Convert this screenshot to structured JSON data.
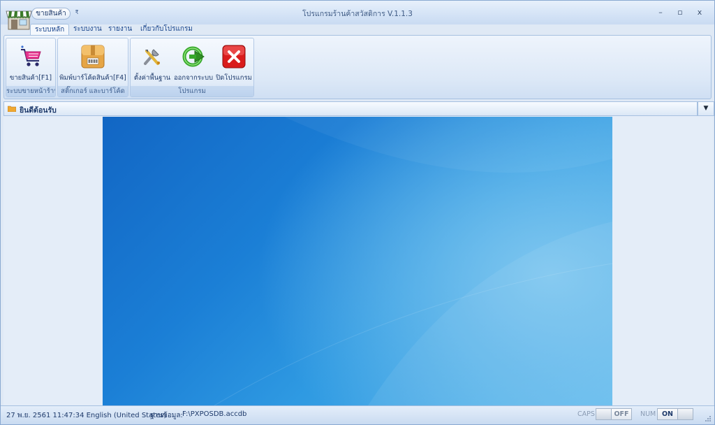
{
  "window": {
    "title": "โปรแกรมร้านค้าสวัสดิการ V.1.1.3",
    "qat_button_label": "ขายสินค้า",
    "qat_dropdown": "₹",
    "controls": {
      "minimize": "–",
      "maximize": "▫",
      "close": "x"
    }
  },
  "tabs": [
    {
      "label": "ระบบหลัก",
      "active": true
    },
    {
      "label": "ระบบงาน",
      "active": false
    },
    {
      "label": "รายงาน",
      "active": false
    },
    {
      "label": "เกี่ยวกับโปรแกรม",
      "active": false
    }
  ],
  "ribbon": {
    "groups": [
      {
        "label": "ระบบขายหน้าร้าน",
        "buttons": [
          {
            "label": "ขายสินค้า[F1]",
            "icon": "shopping-cart-icon"
          }
        ]
      },
      {
        "label": "สติ๊กเกอร์ และบาร์โค้ด",
        "buttons": [
          {
            "label": "พิมพ์บาร์โค้ดสินค้า[F4]",
            "icon": "barcode-box-icon"
          }
        ]
      },
      {
        "label": "โปรแกรม",
        "buttons": [
          {
            "label": "ตั้งค่าพื้นฐาน",
            "icon": "tools-icon"
          },
          {
            "label": "ออกจากระบบ",
            "icon": "logout-icon"
          },
          {
            "label": "ปิดโปรแกรม",
            "icon": "close-program-icon"
          }
        ]
      }
    ]
  },
  "content": {
    "title": "ยินดีต้อนรับ",
    "dropdown": "▼"
  },
  "status": {
    "datetime": "27 พ.ย. 2561 11:47:34 English (United States)",
    "db_label": "ฐานข้อมูล:",
    "db_path": "F:\\PXPOSDB.accdb",
    "caps_label": "CAPS",
    "caps_state": "OFF",
    "num_label": "NUM",
    "num_state": "ON"
  },
  "colors": {
    "accent": "#15428b",
    "ribbon_bg": "#dce8f7",
    "cart_pink": "#e8358f",
    "close_red": "#d91c1c",
    "refresh_green": "#36a82b"
  }
}
